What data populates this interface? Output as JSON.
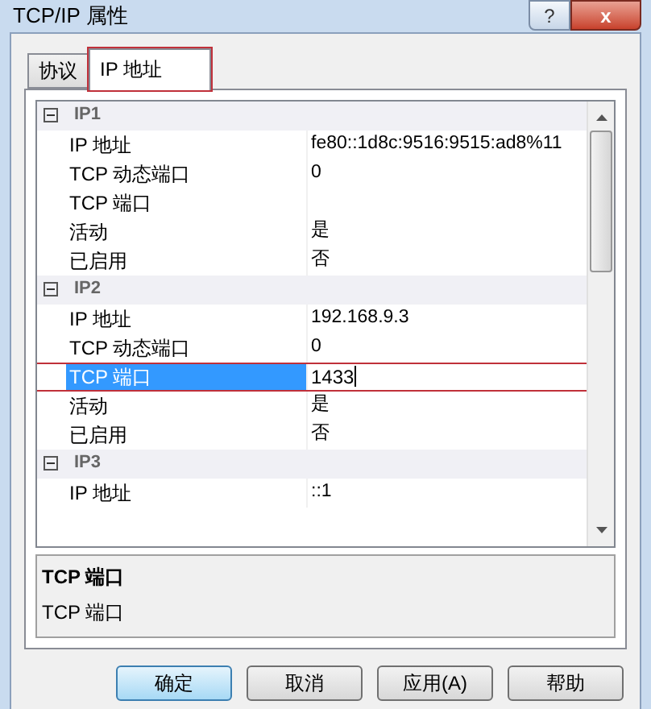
{
  "window": {
    "title": "TCP/IP 属性",
    "buttons": [
      {
        "kind": "help",
        "label": "?"
      },
      {
        "kind": "close",
        "label": "x"
      }
    ]
  },
  "tabs": [
    {
      "label": "协议",
      "selected": false,
      "highlighted": false
    },
    {
      "label": "IP 地址",
      "selected": true,
      "highlighted": true
    }
  ],
  "groups": [
    {
      "name": "IP1",
      "expanded": true,
      "properties": [
        {
          "name": "IP 地址",
          "value": "fe80::1d8c:9516:9515:ad8%11",
          "selected": false,
          "highlighted": false
        },
        {
          "name": "TCP 动态端口",
          "value": "0",
          "selected": false,
          "highlighted": false
        },
        {
          "name": "TCP 端口",
          "selected": false,
          "highlighted": false
        },
        {
          "name": "活动",
          "value": "是",
          "selected": false,
          "highlighted": false
        },
        {
          "name": "已启用",
          "value": "否",
          "selected": false,
          "highlighted": false
        }
      ]
    },
    {
      "name": "IP2",
      "expanded": true,
      "properties": [
        {
          "name": "IP 地址",
          "value": "192.168.9.3",
          "selected": false,
          "highlighted": false
        },
        {
          "name": "TCP 动态端口",
          "value": "0",
          "selected": false,
          "highlighted": false
        },
        {
          "name": "TCP 端口",
          "value": "1433",
          "selected": true,
          "highlighted": true
        },
        {
          "name": "活动",
          "value": "是",
          "selected": false,
          "highlighted": false
        },
        {
          "name": "已启用",
          "value": "否",
          "selected": false,
          "highlighted": false
        }
      ]
    },
    {
      "name": "IP3",
      "expanded": true,
      "properties": [
        {
          "name": "IP 地址",
          "value": "::1",
          "selected": false,
          "highlighted": false
        }
      ]
    }
  ],
  "description": {
    "title": "TCP 端口",
    "text": "TCP 端口"
  },
  "buttons": [
    {
      "label": "确定",
      "default": true
    },
    {
      "label": "取消",
      "default": false
    },
    {
      "label": "应用(A)",
      "default": false
    },
    {
      "label": "帮助",
      "default": false
    }
  ]
}
